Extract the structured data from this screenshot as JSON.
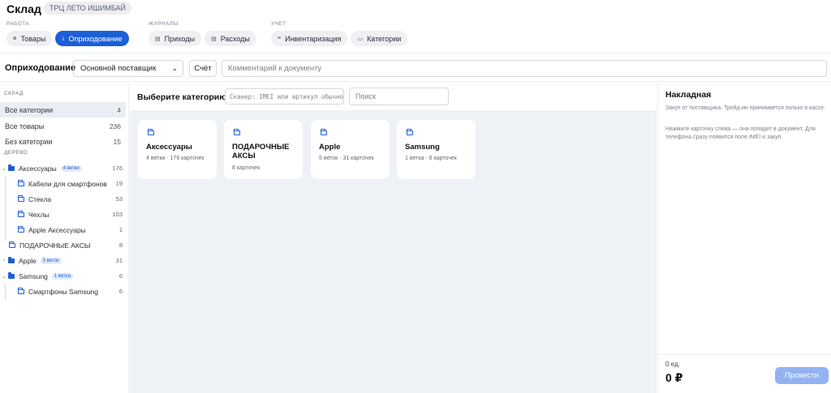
{
  "header": {
    "title": "Склад",
    "store": "ТРЦ ЛЕТО ИШИМБАЙ",
    "groups": [
      {
        "label": "РАБОТА",
        "items": [
          {
            "label": "Товары",
            "icon": "box-icon"
          },
          {
            "label": "Оприходование",
            "icon": "download-icon",
            "active": true
          }
        ]
      },
      {
        "label": "ЖУРНАЛЫ",
        "items": [
          {
            "label": "Приходы",
            "icon": "doc-icon"
          },
          {
            "label": "Расходы",
            "icon": "doc-icon"
          }
        ]
      },
      {
        "label": "УЧЕТ",
        "items": [
          {
            "label": "Инвентаризация",
            "icon": "list-icon"
          },
          {
            "label": "Категории",
            "icon": "folder-icon"
          }
        ]
      }
    ]
  },
  "toolbar": {
    "title": "Оприходование",
    "supplier": "Основной поставщик",
    "account_label": "Счёт",
    "comment_placeholder": "Комментарий к документу"
  },
  "sidebar": {
    "section_label": "СКЛАД",
    "categories": [
      {
        "label": "Все категории",
        "count": "4",
        "active": true
      },
      {
        "label": "Все товары",
        "count": "236"
      },
      {
        "label": "Без категории",
        "count": "15"
      }
    ],
    "tree_label": "ДЕРЕВО",
    "tree": [
      {
        "label": "Аксессуары",
        "count": "176",
        "badge": "4 ветки",
        "expanded": true
      },
      {
        "label": "Кабели для смартфонов",
        "count": "19"
      },
      {
        "label": "Стекла",
        "count": "53"
      },
      {
        "label": "Чехлы",
        "count": "103"
      },
      {
        "label": "Apple Аксессуары",
        "count": "1"
      },
      {
        "label": "ПОДАРОЧНЫЕ АКСЫ",
        "count": "8"
      },
      {
        "label": "Apple",
        "count": "31",
        "badge": "5 веток"
      },
      {
        "label": "Samsung",
        "count": "6",
        "badge": "1 ветка",
        "expanded": true
      },
      {
        "label": "Смартфоны Samsung",
        "count": "6"
      }
    ]
  },
  "main": {
    "title": "Выберите категорию",
    "scanner_placeholder": "Сканер: IMEI или артикул обычного товара",
    "search_placeholder": "Поиск",
    "cards": [
      {
        "title": "Аксессуары",
        "subtitle": "4 ветки · 176 карточек"
      },
      {
        "title": "ПОДАРОЧНЫЕ АКСЫ",
        "subtitle": "8 карточек"
      },
      {
        "title": "Apple",
        "subtitle": "5 веток · 31 карточек"
      },
      {
        "title": "Samsung",
        "subtitle": "1 ветка · 6 карточек"
      }
    ]
  },
  "invoice": {
    "title": "Накладная",
    "text1": "Закуп от поставщика. Трейд-ин принимается только в кассе.",
    "text2": "Нажмите карточку слева — она попадет в документ. Для телефона сразу появится поле IMEI и закуп.",
    "count": "0 ед.",
    "total": "0 ₽",
    "submit": "Провести"
  },
  "colors": {
    "accent": "#1b5fd6",
    "submit_disabled": "#92b3f0",
    "main_bg": "#eef1f6"
  }
}
